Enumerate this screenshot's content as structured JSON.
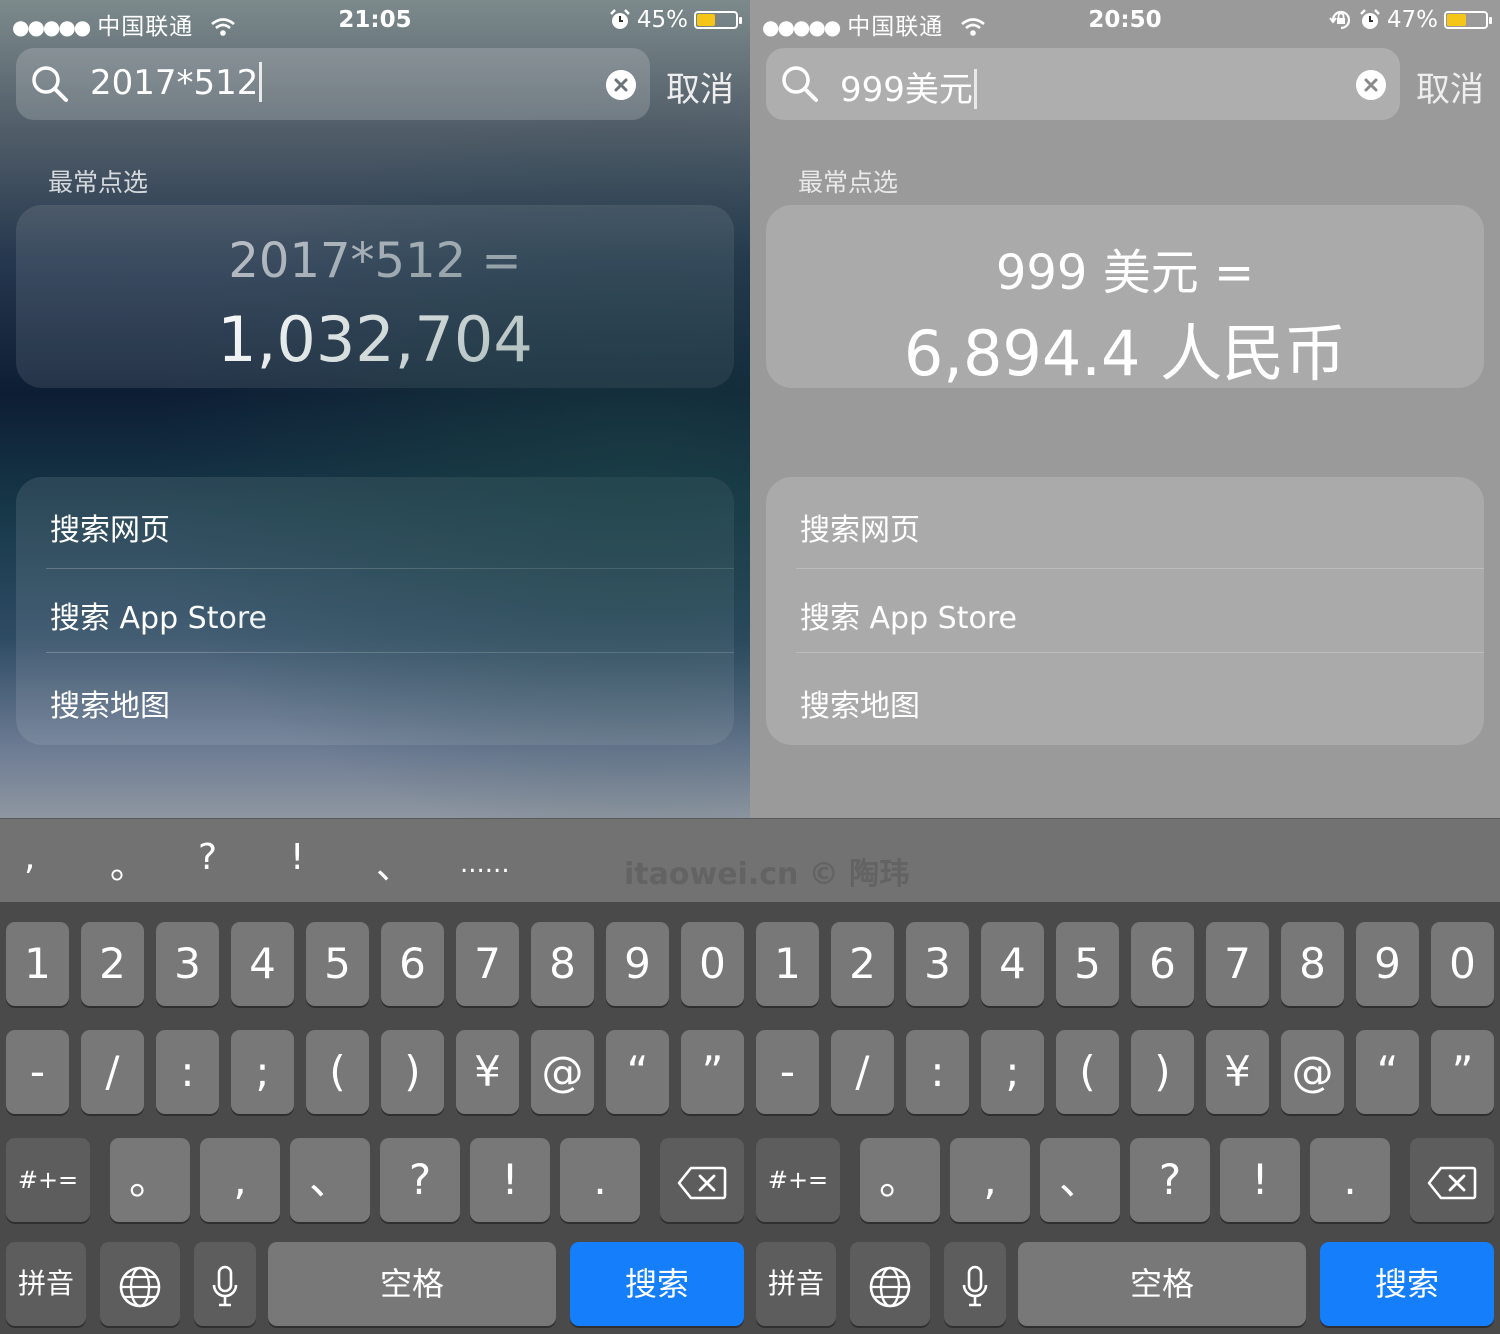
{
  "panels": {
    "left": {
      "status": {
        "carrier": "中国联通",
        "time": "21:05",
        "battery_text": "45%",
        "battery_level": 0.45
      },
      "search": {
        "query": "2017*512",
        "cancel_label": "取消"
      },
      "section_title": "最常点选",
      "calc": {
        "expression": "2017*512 =",
        "result": "1,032,704"
      },
      "actions": [
        "搜索网页",
        "搜索 App Store",
        "搜索地图"
      ]
    },
    "right": {
      "status": {
        "carrier": "中国联通",
        "time": "20:50",
        "battery_text": "47%",
        "battery_level": 0.47
      },
      "search": {
        "query": "999美元",
        "cancel_label": "取消"
      },
      "section_title": "最常点选",
      "calc": {
        "expression": "999 美元 =",
        "result": "6,894.4 人民币"
      },
      "actions": [
        "搜索网页",
        "搜索 App Store",
        "搜索地图"
      ]
    }
  },
  "punct_suggestions": [
    ",",
    "。",
    "?",
    "!",
    "、",
    "......"
  ],
  "watermark": "itaowei.cn © 陶玮",
  "keyboard": {
    "row1": [
      "1",
      "2",
      "3",
      "4",
      "5",
      "6",
      "7",
      "8",
      "9",
      "0"
    ],
    "row2": [
      "-",
      "/",
      ":",
      ";",
      "(",
      ")",
      "¥",
      "@",
      "“",
      "”"
    ],
    "row3": [
      "。",
      ",",
      "、",
      "?",
      "!",
      "."
    ],
    "more_label": "#+=",
    "pinyin_label": "拼音",
    "space_label": "空格",
    "search_label": "搜索"
  },
  "colors": {
    "accent": "#147efb",
    "battery_fill": "#f5c518",
    "key": "#787878",
    "key_dark": "#5d5d5d"
  },
  "icons": [
    "search-icon",
    "clear-icon",
    "wifi-icon",
    "alarm-icon",
    "rotation-lock-icon",
    "battery-icon",
    "backspace-icon",
    "globe-icon",
    "microphone-icon"
  ]
}
